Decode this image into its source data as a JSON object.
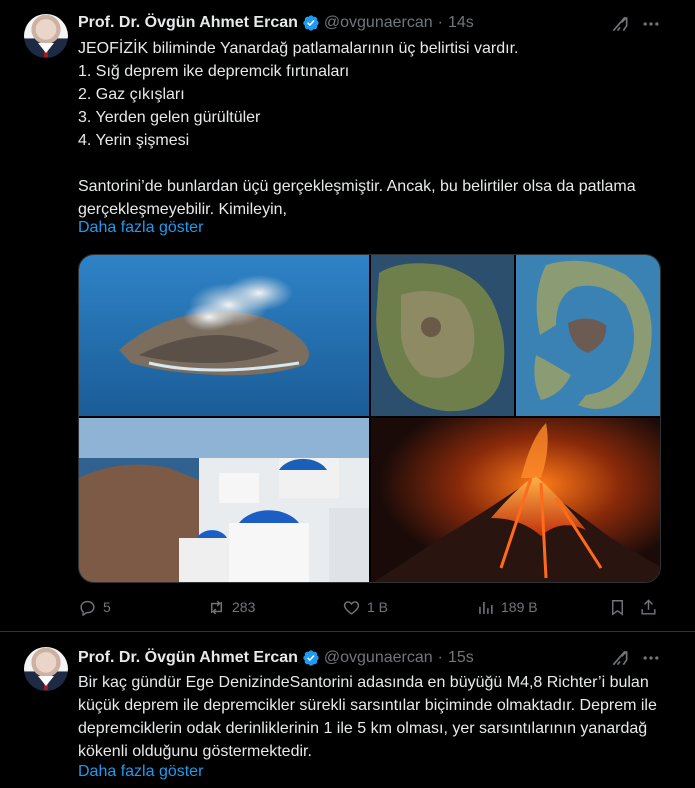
{
  "tweets": [
    {
      "author_name": "Prof. Dr. Övgün Ahmet Ercan",
      "handle": "@ovgunaercan",
      "separator": "·",
      "time": "14s",
      "text": "JEOFİZİK biliminde Yanardağ patlamalarının üç belirtisi vardır.\n1. Sığ deprem ike depremcik fırtınaları\n2. Gaz çıkışları\n3. Yerden gelen gürültüler\n4. Yerin şişmesi\n\nSantorini’de bunlardan üçü gerçekleşmiştir. Ancak, bu belirtiler olsa da patlama gerçekleşmeyebilir. Kimileyin,",
      "show_more": "Daha fazla göster",
      "media_icons": [
        "volcanic-island-smoke-photo",
        "island-satellite-photo",
        "caldera-satellite-photo",
        "santorini-village-photo",
        "erupting-volcano-photo"
      ],
      "actions": {
        "replies": "5",
        "reposts": "283",
        "likes": "1 B",
        "views": "189 B"
      }
    },
    {
      "author_name": "Prof. Dr. Övgün Ahmet Ercan",
      "handle": "@ovgunaercan",
      "separator": "·",
      "time": "15s",
      "text": "Bir kaç gündür Ege DenizindeSantorini adasında en büyüğü M4,8 Richter’i bulan küçük deprem ile depremcikler sürekli sarsıntılar biçiminde olmaktadır. Deprem ile depremciklerin odak derinliklerinin 1 ile 5 km olması, yer sarsıntılarının yanardağ kökenli olduğunu göstermektedir.",
      "show_more": "Daha fazla göster"
    }
  ],
  "colors": {
    "background": "#000000",
    "text": "#e7e9ea",
    "muted": "#71767b",
    "link": "#1d9bf0",
    "verified": "#1d9bf0",
    "divider": "#2f3336"
  }
}
